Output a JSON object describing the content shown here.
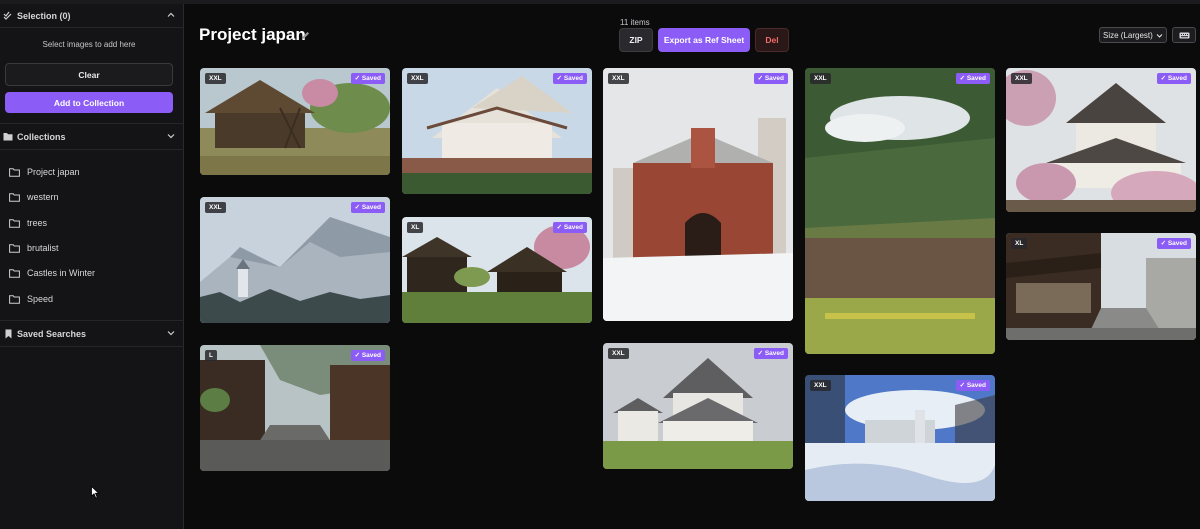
{
  "sidebar": {
    "selection": {
      "label": "Selection (0)",
      "hint": "Select images to add here",
      "clear_label": "Clear",
      "add_label": "Add to Collection"
    },
    "collections": {
      "label": "Collections",
      "items": [
        {
          "label": "Project japan"
        },
        {
          "label": "western"
        },
        {
          "label": "trees"
        },
        {
          "label": "brutalist"
        },
        {
          "label": "Castles in Winter"
        },
        {
          "label": "Speed"
        }
      ]
    },
    "saved_searches": {
      "label": "Saved Searches"
    }
  },
  "main": {
    "title": "Project japan",
    "item_count": "11 items",
    "zip_label": "ZIP",
    "export_label": "Export as Ref Sheet",
    "del_label": "Del",
    "size_select_value": "Size (Largest)",
    "saved_label": "✓ Saved",
    "cards": [
      {
        "size": "XXL",
        "subject": "thatched farmhouse"
      },
      {
        "size": "XXL",
        "subject": "snowy alpine castle"
      },
      {
        "size": "L",
        "subject": "old japanese street"
      },
      {
        "size": "XXL",
        "subject": "white japanese castle"
      },
      {
        "size": "XL",
        "subject": "traditional village houses"
      },
      {
        "size": "XXL",
        "subject": "red castle gate in snow"
      },
      {
        "size": "XXL",
        "subject": "himeji castle"
      },
      {
        "size": "XXL",
        "subject": "mountain valley village"
      },
      {
        "size": "XXL",
        "subject": "snowy castle lake"
      },
      {
        "size": "XXL",
        "subject": "castle with cherry blossoms"
      },
      {
        "size": "XL",
        "subject": "wooden street shops"
      }
    ]
  },
  "colors": {
    "accent": "#8b5cf6",
    "danger": "#f06b6b",
    "background": "#0b0b0c",
    "sidebar": "#141416"
  }
}
